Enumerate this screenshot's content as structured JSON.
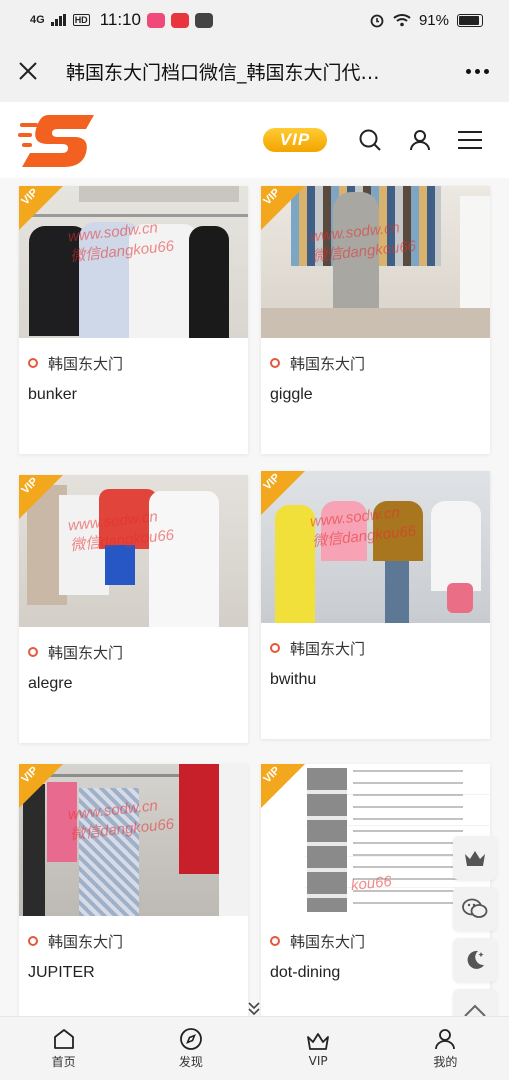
{
  "status_bar": {
    "signal": "4G",
    "hd": "HD",
    "time": "11:10",
    "battery": "91%"
  },
  "title_bar": {
    "title": "韩国东大门档口微信_韩国东大门代…"
  },
  "header": {
    "vip_label": "VIP",
    "logo_letter": "S"
  },
  "cards": [
    {
      "location": "韩国东大门",
      "name": "bunker",
      "vip": "VIP",
      "watermark_1": "www.sodw.cn",
      "watermark_2": "微信dangkou66"
    },
    {
      "location": "韩国东大门",
      "name": "giggle",
      "vip": "VIP",
      "watermark_1": "www.sodw.cn",
      "watermark_2": "微信dangkou66"
    },
    {
      "location": "韩国东大门",
      "name": "alegre",
      "vip": "VIP",
      "watermark_1": "www.sodw.cn",
      "watermark_2": "微信dangkou66"
    },
    {
      "location": "韩国东大门",
      "name": "bwithu",
      "vip": "VIP",
      "watermark_1": "www.sodw.cn",
      "watermark_2": "微信dangkou66"
    },
    {
      "location": "韩国东大门",
      "name": "JUPITER",
      "vip": "VIP",
      "watermark_1": "www.sodw.cn",
      "watermark_2": "微信dangkou66"
    },
    {
      "location": "韩国东大门",
      "name": "dot-dining",
      "vip": "VIP",
      "watermark_1": "",
      "watermark_2": "kou66"
    }
  ],
  "bottom_nav": [
    {
      "label": "首页",
      "icon": "home-icon"
    },
    {
      "label": "发现",
      "icon": "compass-icon"
    },
    {
      "label": "VIP",
      "icon": "crown-icon"
    },
    {
      "label": "我的",
      "icon": "user-icon"
    }
  ],
  "colors": {
    "accent": "#f2a71c",
    "logo": "#f2611f",
    "location_dot": "#e5583b"
  }
}
